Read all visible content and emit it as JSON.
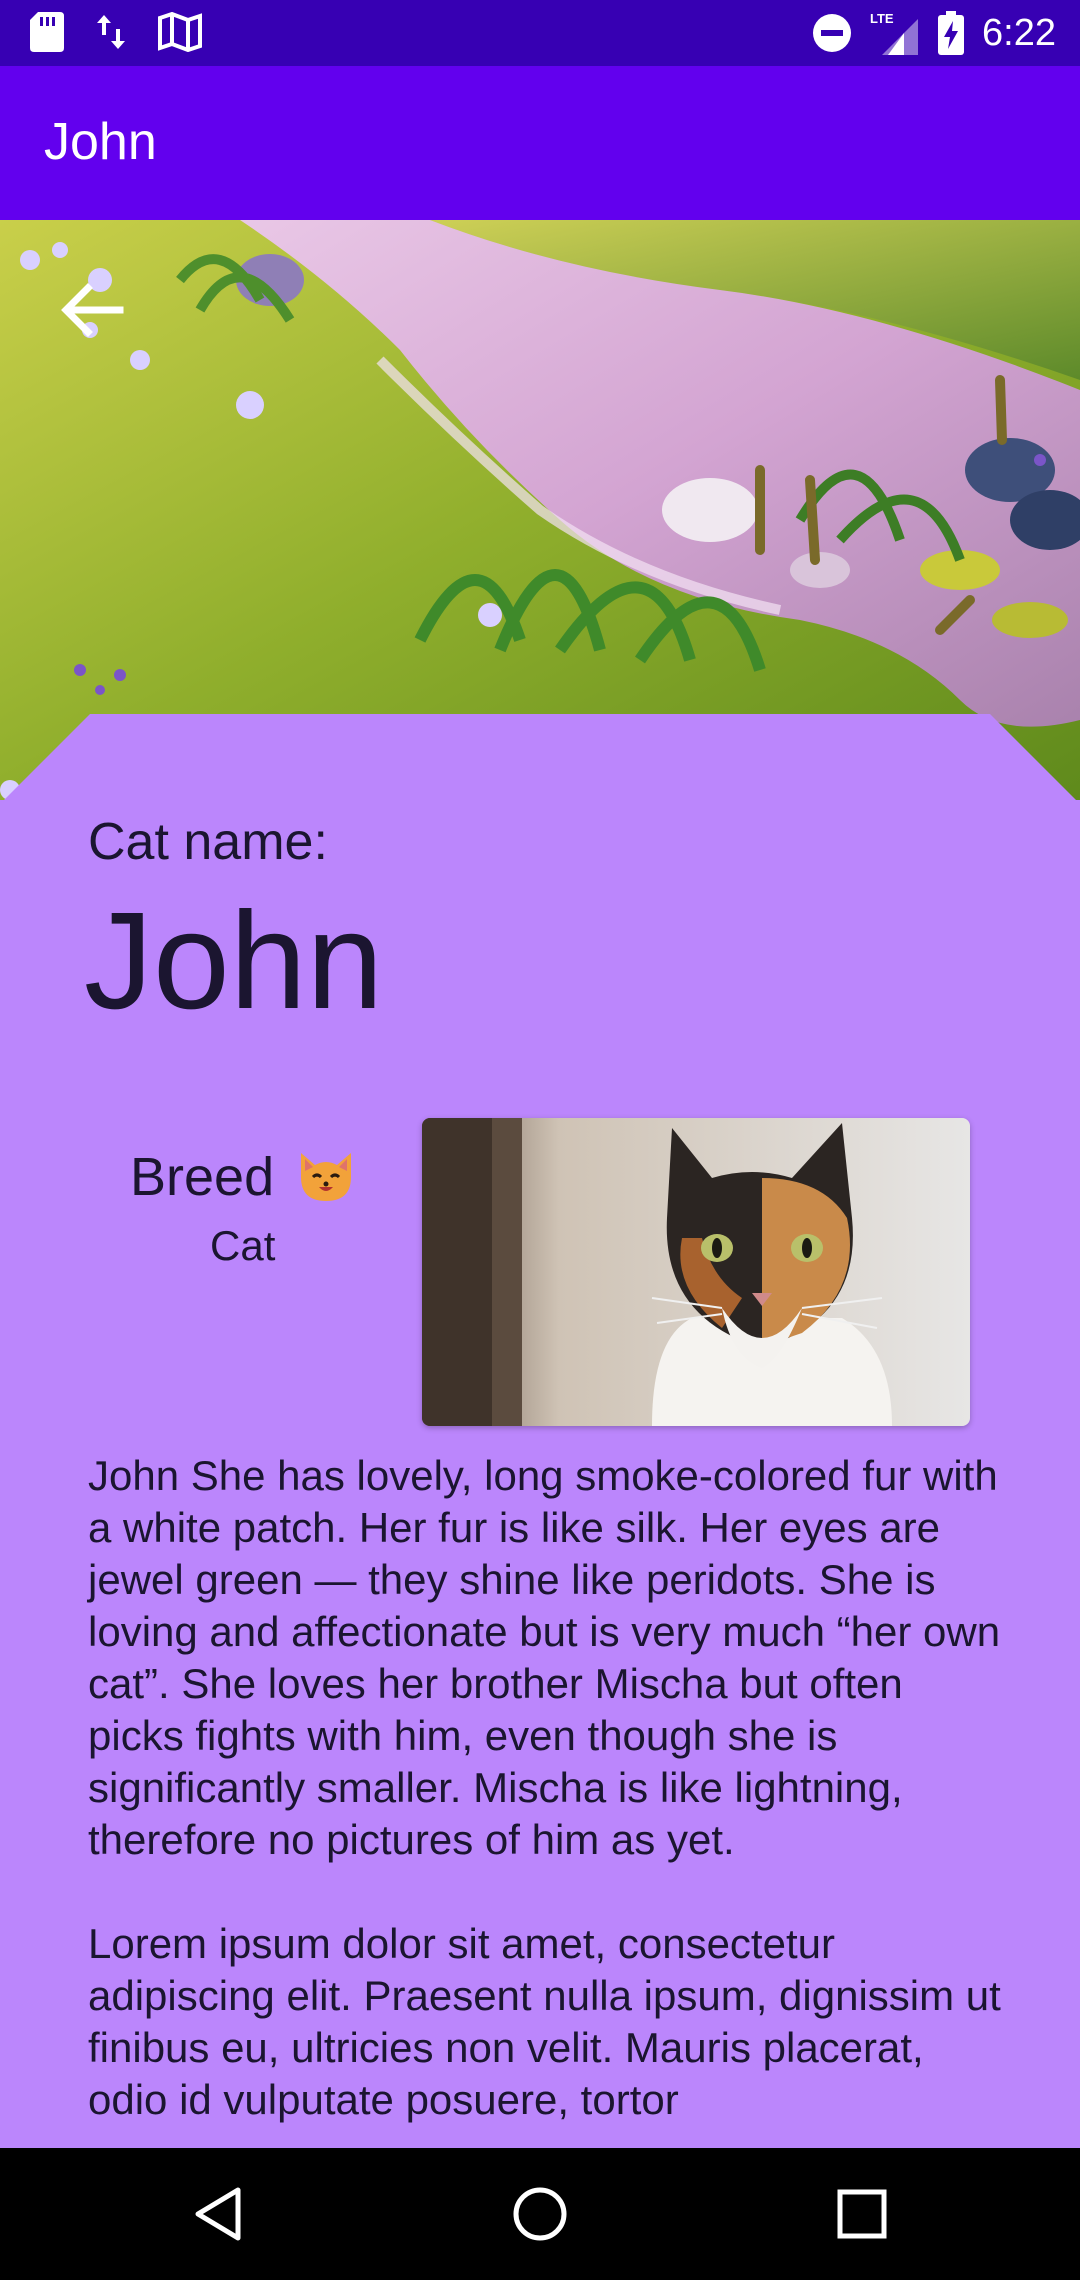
{
  "status_bar": {
    "time": "6:22",
    "left_icons": [
      "sd-card-icon",
      "data-transfer-icon",
      "map-icon"
    ],
    "right_icons": [
      "do-not-disturb-icon",
      "lte-signal-icon",
      "battery-charging-icon"
    ]
  },
  "app_bar": {
    "title": "John"
  },
  "header": {
    "back_icon": "arrow-back-icon"
  },
  "card": {
    "cat_name_label": "Cat name:",
    "cat_name": "John",
    "breed_label": "Breed",
    "breed_emoji": "cat-face-icon",
    "breed_value": "Cat",
    "description": "John She has lovely, long smoke-colored fur with a white patch. Her fur is like silk. Her eyes are jewel green — they shine like peridots. She is loving and affectionate but is very much “her own cat”. She loves her brother Mischa but often picks fights with him, even though she is significantly smaller. Mischa is like lightning, therefore no pictures of him as yet.\n\nLorem ipsum dolor sit amet, consectetur adipiscing elit. Praesent nulla ipsum, dignissim ut finibus eu, ultricies non velit. Mauris placerat, odio id vulputate posuere, tortor"
  },
  "nav_bar": {
    "icons": [
      "back-triangle-icon",
      "home-circle-icon",
      "recents-square-icon"
    ]
  },
  "colors": {
    "status_bar": "#3700B3",
    "app_bar": "#6200EE",
    "card_background": "#BB86FC",
    "text": "#1b1530"
  }
}
